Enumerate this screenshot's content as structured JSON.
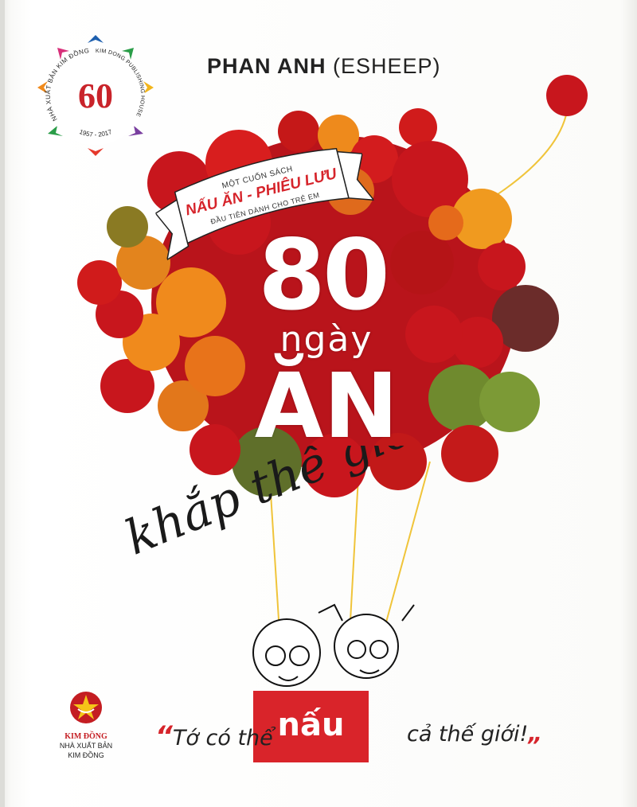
{
  "author": {
    "name": "PHAN ANH",
    "pen_name": "(ESHEEP)"
  },
  "seal": {
    "number": "60",
    "arc_left": "NHÀ XUẤT BẢN KIM ĐỒNG",
    "arc_right": "KIM DONG PUBLISHING HOUSE",
    "years": "1957 - 2017"
  },
  "ribbon": {
    "line1": "MỘT CUỐN SÁCH",
    "line2": "NẤU ĂN - PHIÊU LƯU",
    "line3": "ĐẦU TIÊN DÀNH CHO TRẺ EM"
  },
  "title": {
    "number": "80",
    "word_days": "ngày",
    "word_eat": "ĂN",
    "script": "khắp thế giới"
  },
  "quote": {
    "open_mark": "“",
    "before": "Tớ có thể",
    "highlight": "nấu",
    "after": "cả thế giới!",
    "close_mark": "„"
  },
  "publisher": {
    "brand": "KIM ĐỒNG",
    "line1": "NHÀ XUẤT BẢN",
    "line2": "KIM ĐỒNG"
  },
  "colors": {
    "accent_red": "#d9242a",
    "tomato_red": "#c8161d",
    "tomato_orange": "#e8731a",
    "tomato_green": "#6a7d2a"
  }
}
